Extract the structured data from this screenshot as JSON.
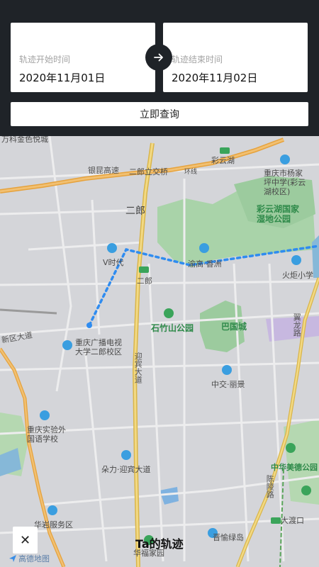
{
  "top": {
    "start_label": "轨迹开始时间",
    "start_value": "2020年11月01日",
    "end_label": "轨迹结束时间",
    "end_value": "2020年11月02日",
    "query_button": "立即查询"
  },
  "map": {
    "labels": {
      "wanfang": "万科金色悦城",
      "yinkun": "银昆高速",
      "erlang_jiao": "二郎立交桥",
      "caiyunhu": "彩云湖",
      "huanxian": "环线",
      "school_yangjia": "重庆市杨家坪中学(彩云湖校区)",
      "wetland": "彩云湖国家湿地公园",
      "erlang": "二郎",
      "vshidai": "V时代",
      "yuxiang": "渝高·香洲",
      "huoju": "火炬小学",
      "erlang_station": "二郎",
      "shizhushan": "石竹山公园",
      "baguocheng": "巴国城",
      "xinqu": "新区大道",
      "guangbo": "重庆广播电视大学二郎校区",
      "yingbin": "迎宾大道",
      "yilong": "翼龙路",
      "zhongjiao": "中交·丽景",
      "waiyu": "重庆实验外国语学校",
      "duoli": "朵力·迎宾大道",
      "zhonghua": "中华美德公园",
      "chenlu": "陈陵路",
      "huayan": "华岩服务区",
      "dadukou": "大渡口",
      "jinyu": "晋愉绿岛",
      "huafu": "华福家园"
    },
    "track_title": "Ta的轨迹",
    "logo": "高德地图",
    "close": "✕"
  }
}
